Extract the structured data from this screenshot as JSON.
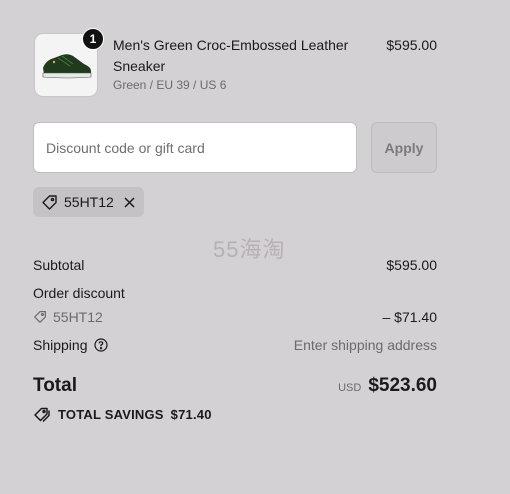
{
  "product": {
    "quantity": "1",
    "name": "Men's Green Croc-Embossed Leather Sneaker",
    "variant": "Green / EU 39 / US 6",
    "price": "$595.00",
    "image_icon": "sneaker-image"
  },
  "discount": {
    "placeholder": "Discount code or gift card",
    "apply_label": "Apply",
    "applied_code": "55HT12"
  },
  "watermark": "55海淘",
  "summary": {
    "subtotal_label": "Subtotal",
    "subtotal_value": "$595.00",
    "order_discount_label": "Order discount",
    "discount_code": "55HT12",
    "discount_value": "– $71.40",
    "shipping_label": "Shipping",
    "shipping_value": "Enter shipping address",
    "total_label": "Total",
    "currency": "USD",
    "total_value": "$523.60",
    "savings_label": "TOTAL SAVINGS",
    "savings_value": "$71.40"
  },
  "colors": {
    "background": "#d3d1d3",
    "badge": "#111111",
    "sneaker_green": "#1f3a1c"
  }
}
